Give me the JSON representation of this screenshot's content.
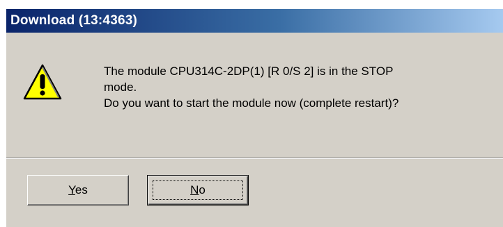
{
  "window": {
    "title": "Download (13:4363)"
  },
  "message": {
    "icon": "warning-icon",
    "line1": "The module CPU314C-2DP(1) [R 0/S 2] is in the STOP",
    "line2": "mode.",
    "line3": "Do you want to start the module now (complete restart)?"
  },
  "buttons": {
    "yes": {
      "mnemonic": "Y",
      "rest": "es"
    },
    "no": {
      "mnemonic": "N",
      "rest": "o"
    }
  },
  "colors": {
    "titlebar_start": "#0a246a",
    "titlebar_end": "#a6caf0",
    "dialog_face": "#d4d0c8",
    "warning_fill": "#ffff00"
  }
}
